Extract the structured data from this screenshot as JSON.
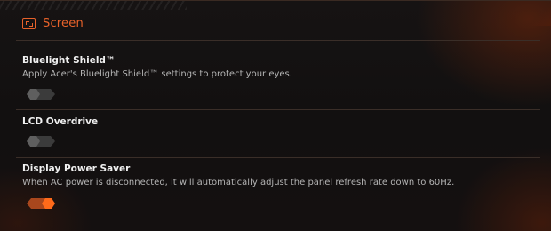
{
  "section": {
    "title": "Screen",
    "icon": "screen-icon",
    "accent_color": "#e8622a"
  },
  "settings": [
    {
      "title": "Bluelight Shield™",
      "description": "Apply Acer's Bluelight Shield™ settings to protect your eyes.",
      "enabled": false
    },
    {
      "title": "LCD Overdrive",
      "description": "",
      "enabled": false
    },
    {
      "title": "Display Power Saver",
      "description": "When AC power is disconnected, it will automatically adjust the panel refresh rate down to 60Hz.",
      "enabled": true
    }
  ],
  "colors": {
    "toggle_on": "#ff6a1a",
    "toggle_off": "#3b3b3b"
  }
}
